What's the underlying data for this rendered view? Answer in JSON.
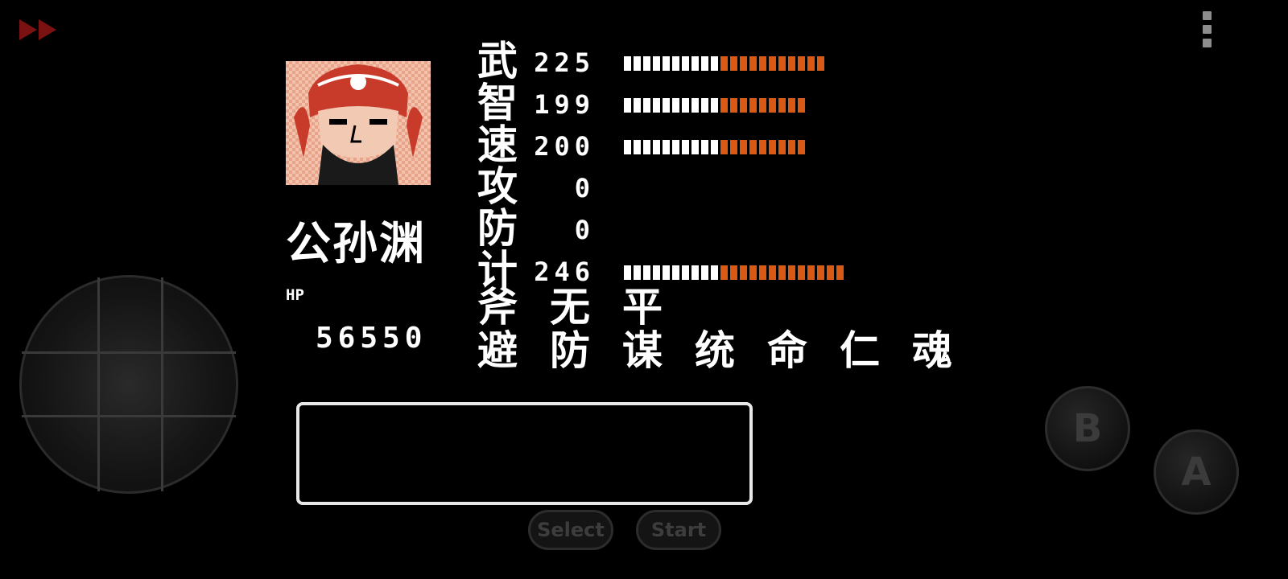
{
  "hero": {
    "name": "公孙渊",
    "hp_label": "HP",
    "hp_value": "56550",
    "portrait_icon": "general-portrait-icon"
  },
  "stats": [
    {
      "label": "武",
      "value": "225",
      "bar_white": 10,
      "bar_orange": 11
    },
    {
      "label": "智",
      "value": "199",
      "bar_white": 10,
      "bar_orange": 9
    },
    {
      "label": "速",
      "value": "200",
      "bar_white": 10,
      "bar_orange": 9
    },
    {
      "label": "攻",
      "value": "0",
      "bar_white": 0,
      "bar_orange": 0
    },
    {
      "label": "防",
      "value": "0",
      "bar_white": 0,
      "bar_orange": 0
    },
    {
      "label": "计",
      "value": "246",
      "bar_white": 10,
      "bar_orange": 13
    }
  ],
  "equipment": [
    "斧",
    "无",
    "平"
  ],
  "skills": [
    "避",
    "防",
    "谋",
    "统",
    "命",
    "仁",
    "魂"
  ],
  "controls": {
    "fast_forward_icon": "fast-forward-icon",
    "menu_icon": "more-vertical-icon",
    "b_label": "B",
    "a_label": "A",
    "select_label": "Select",
    "start_label": "Start"
  },
  "colors": {
    "bar_white": "#ffffff",
    "bar_orange": "#d85a14",
    "fast_forward": "#7a1212",
    "background": "#000000"
  }
}
